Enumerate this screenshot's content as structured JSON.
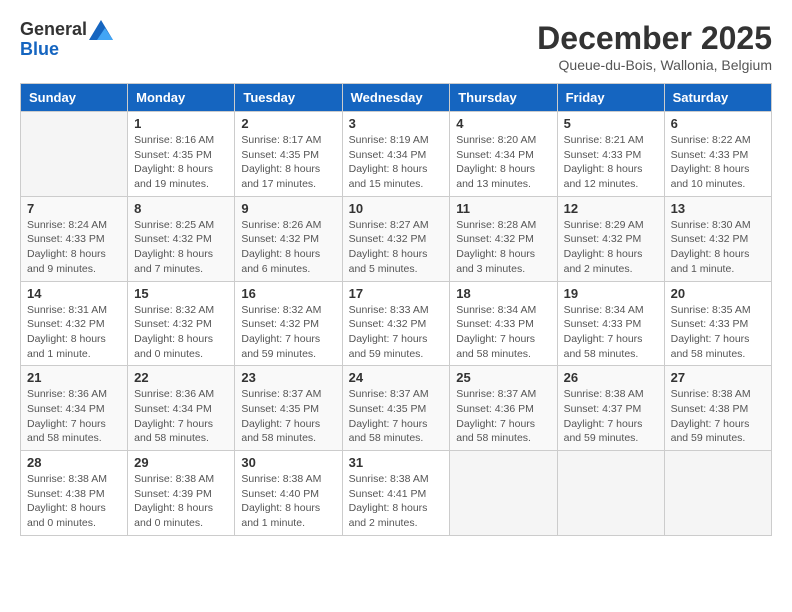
{
  "logo": {
    "general": "General",
    "blue": "Blue"
  },
  "title": "December 2025",
  "location": "Queue-du-Bois, Wallonia, Belgium",
  "days_of_week": [
    "Sunday",
    "Monday",
    "Tuesday",
    "Wednesday",
    "Thursday",
    "Friday",
    "Saturday"
  ],
  "weeks": [
    [
      {
        "day": "",
        "info": ""
      },
      {
        "day": "1",
        "info": "Sunrise: 8:16 AM\nSunset: 4:35 PM\nDaylight: 8 hours\nand 19 minutes."
      },
      {
        "day": "2",
        "info": "Sunrise: 8:17 AM\nSunset: 4:35 PM\nDaylight: 8 hours\nand 17 minutes."
      },
      {
        "day": "3",
        "info": "Sunrise: 8:19 AM\nSunset: 4:34 PM\nDaylight: 8 hours\nand 15 minutes."
      },
      {
        "day": "4",
        "info": "Sunrise: 8:20 AM\nSunset: 4:34 PM\nDaylight: 8 hours\nand 13 minutes."
      },
      {
        "day": "5",
        "info": "Sunrise: 8:21 AM\nSunset: 4:33 PM\nDaylight: 8 hours\nand 12 minutes."
      },
      {
        "day": "6",
        "info": "Sunrise: 8:22 AM\nSunset: 4:33 PM\nDaylight: 8 hours\nand 10 minutes."
      }
    ],
    [
      {
        "day": "7",
        "info": "Sunrise: 8:24 AM\nSunset: 4:33 PM\nDaylight: 8 hours\nand 9 minutes."
      },
      {
        "day": "8",
        "info": "Sunrise: 8:25 AM\nSunset: 4:32 PM\nDaylight: 8 hours\nand 7 minutes."
      },
      {
        "day": "9",
        "info": "Sunrise: 8:26 AM\nSunset: 4:32 PM\nDaylight: 8 hours\nand 6 minutes."
      },
      {
        "day": "10",
        "info": "Sunrise: 8:27 AM\nSunset: 4:32 PM\nDaylight: 8 hours\nand 5 minutes."
      },
      {
        "day": "11",
        "info": "Sunrise: 8:28 AM\nSunset: 4:32 PM\nDaylight: 8 hours\nand 3 minutes."
      },
      {
        "day": "12",
        "info": "Sunrise: 8:29 AM\nSunset: 4:32 PM\nDaylight: 8 hours\nand 2 minutes."
      },
      {
        "day": "13",
        "info": "Sunrise: 8:30 AM\nSunset: 4:32 PM\nDaylight: 8 hours\nand 1 minute."
      }
    ],
    [
      {
        "day": "14",
        "info": "Sunrise: 8:31 AM\nSunset: 4:32 PM\nDaylight: 8 hours\nand 1 minute."
      },
      {
        "day": "15",
        "info": "Sunrise: 8:32 AM\nSunset: 4:32 PM\nDaylight: 8 hours\nand 0 minutes."
      },
      {
        "day": "16",
        "info": "Sunrise: 8:32 AM\nSunset: 4:32 PM\nDaylight: 7 hours\nand 59 minutes."
      },
      {
        "day": "17",
        "info": "Sunrise: 8:33 AM\nSunset: 4:32 PM\nDaylight: 7 hours\nand 59 minutes."
      },
      {
        "day": "18",
        "info": "Sunrise: 8:34 AM\nSunset: 4:33 PM\nDaylight: 7 hours\nand 58 minutes."
      },
      {
        "day": "19",
        "info": "Sunrise: 8:34 AM\nSunset: 4:33 PM\nDaylight: 7 hours\nand 58 minutes."
      },
      {
        "day": "20",
        "info": "Sunrise: 8:35 AM\nSunset: 4:33 PM\nDaylight: 7 hours\nand 58 minutes."
      }
    ],
    [
      {
        "day": "21",
        "info": "Sunrise: 8:36 AM\nSunset: 4:34 PM\nDaylight: 7 hours\nand 58 minutes."
      },
      {
        "day": "22",
        "info": "Sunrise: 8:36 AM\nSunset: 4:34 PM\nDaylight: 7 hours\nand 58 minutes."
      },
      {
        "day": "23",
        "info": "Sunrise: 8:37 AM\nSunset: 4:35 PM\nDaylight: 7 hours\nand 58 minutes."
      },
      {
        "day": "24",
        "info": "Sunrise: 8:37 AM\nSunset: 4:35 PM\nDaylight: 7 hours\nand 58 minutes."
      },
      {
        "day": "25",
        "info": "Sunrise: 8:37 AM\nSunset: 4:36 PM\nDaylight: 7 hours\nand 58 minutes."
      },
      {
        "day": "26",
        "info": "Sunrise: 8:38 AM\nSunset: 4:37 PM\nDaylight: 7 hours\nand 59 minutes."
      },
      {
        "day": "27",
        "info": "Sunrise: 8:38 AM\nSunset: 4:38 PM\nDaylight: 7 hours\nand 59 minutes."
      }
    ],
    [
      {
        "day": "28",
        "info": "Sunrise: 8:38 AM\nSunset: 4:38 PM\nDaylight: 8 hours\nand 0 minutes."
      },
      {
        "day": "29",
        "info": "Sunrise: 8:38 AM\nSunset: 4:39 PM\nDaylight: 8 hours\nand 0 minutes."
      },
      {
        "day": "30",
        "info": "Sunrise: 8:38 AM\nSunset: 4:40 PM\nDaylight: 8 hours\nand 1 minute."
      },
      {
        "day": "31",
        "info": "Sunrise: 8:38 AM\nSunset: 4:41 PM\nDaylight: 8 hours\nand 2 minutes."
      },
      {
        "day": "",
        "info": ""
      },
      {
        "day": "",
        "info": ""
      },
      {
        "day": "",
        "info": ""
      }
    ]
  ]
}
